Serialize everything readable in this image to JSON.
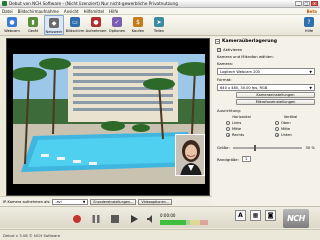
{
  "window": {
    "title": "Debut von NCH Software - (Nicht lizenziert) Nur nicht-gewerbliche Privatnutzung",
    "controls": [
      "_",
      "□",
      "×"
    ]
  },
  "menu": {
    "items": [
      "Datei",
      "Bildschirmaufnahme",
      "Ansicht",
      "Hilfsmittel",
      "Hilfe"
    ],
    "beta": "Beta"
  },
  "toolbar": {
    "buttons": [
      {
        "label": "Webcam",
        "icon": "webcam-icon",
        "color": "#3a7bd5",
        "glyph": "●"
      },
      {
        "label": "Gerät",
        "icon": "device-icon",
        "color": "#5b8f3b",
        "glyph": "▮"
      },
      {
        "label": "Netzwerk",
        "icon": "network-icon",
        "color": "#6a6a6a",
        "glyph": "◆"
      },
      {
        "label": "Bildschirm",
        "icon": "screen-icon",
        "color": "#2f6fb0",
        "glyph": "▭"
      },
      {
        "label": "Aufnehmen",
        "icon": "record-icon",
        "color": "#b32d2d",
        "glyph": "●"
      },
      {
        "label": "Optionen",
        "icon": "options-icon",
        "color": "#7a5fb0",
        "glyph": "✓"
      },
      {
        "label": "Kaufen",
        "icon": "buy-icon",
        "color": "#c47a16",
        "glyph": "$"
      },
      {
        "label": "Teilen",
        "icon": "share-icon",
        "color": "#3b8ca0",
        "glyph": "➤"
      }
    ],
    "help": {
      "label": "Hilfe",
      "icon": "help-icon",
      "color": "#2f6fb0",
      "glyph": "?"
    }
  },
  "panel": {
    "title": "Kameraüberlagerung",
    "activated_label": "Aktivieren",
    "select_label": "Kamera und Mikrofon wählen:",
    "camera_label": "Kamera:",
    "camera_value": "Logitech Webcam 200",
    "format_label": "Format:",
    "format_value": "640 x 480, 30.00 fps, RGB",
    "camera_settings_btn": "Kameraeinstellungen",
    "mic_settings_btn": "Mikrofoneinstellungen",
    "alignment_label": "Ausrichtung:",
    "horizontal_label": "Horizontal",
    "vertical_label": "Vertikal",
    "horizontal_options": [
      "Links",
      "Mitte",
      "Rechts"
    ],
    "vertical_options": [
      "Oben",
      "Mitte",
      "Unten"
    ],
    "size_label": "Größe:",
    "size_value": "30 %",
    "size_fraction": 0.3,
    "margin_label": "Randgröße:",
    "margin_value": "2"
  },
  "bottom": {
    "record_as_label": "IP-Kamera aufnehmen als:",
    "format_value": ".avi",
    "encoder_btn": "Encodereinstellungen...",
    "video_options_btn": "Videooptionen..."
  },
  "controls": {
    "time": "0:00:00",
    "tools": [
      {
        "icon": "text-overlay-icon",
        "glyph": "A"
      },
      {
        "icon": "image-overlay-icon",
        "glyph": "▦"
      },
      {
        "icon": "snapshot-icon",
        "glyph": "◙"
      },
      {
        "icon": "color-adjust-icon",
        "glyph": "▤"
      }
    ],
    "logo": "NCH"
  },
  "status": {
    "text": "Debut v 3.08 © NCH Software"
  },
  "colors": {
    "record": "#c4342f",
    "pause": "#6b6b6b",
    "stop": "#5a5a5a",
    "play": "#3a3a3a",
    "meter_green": "#3fbf3f",
    "meter_yellow": "#d8cf2c",
    "meter_red": "#d64040"
  }
}
